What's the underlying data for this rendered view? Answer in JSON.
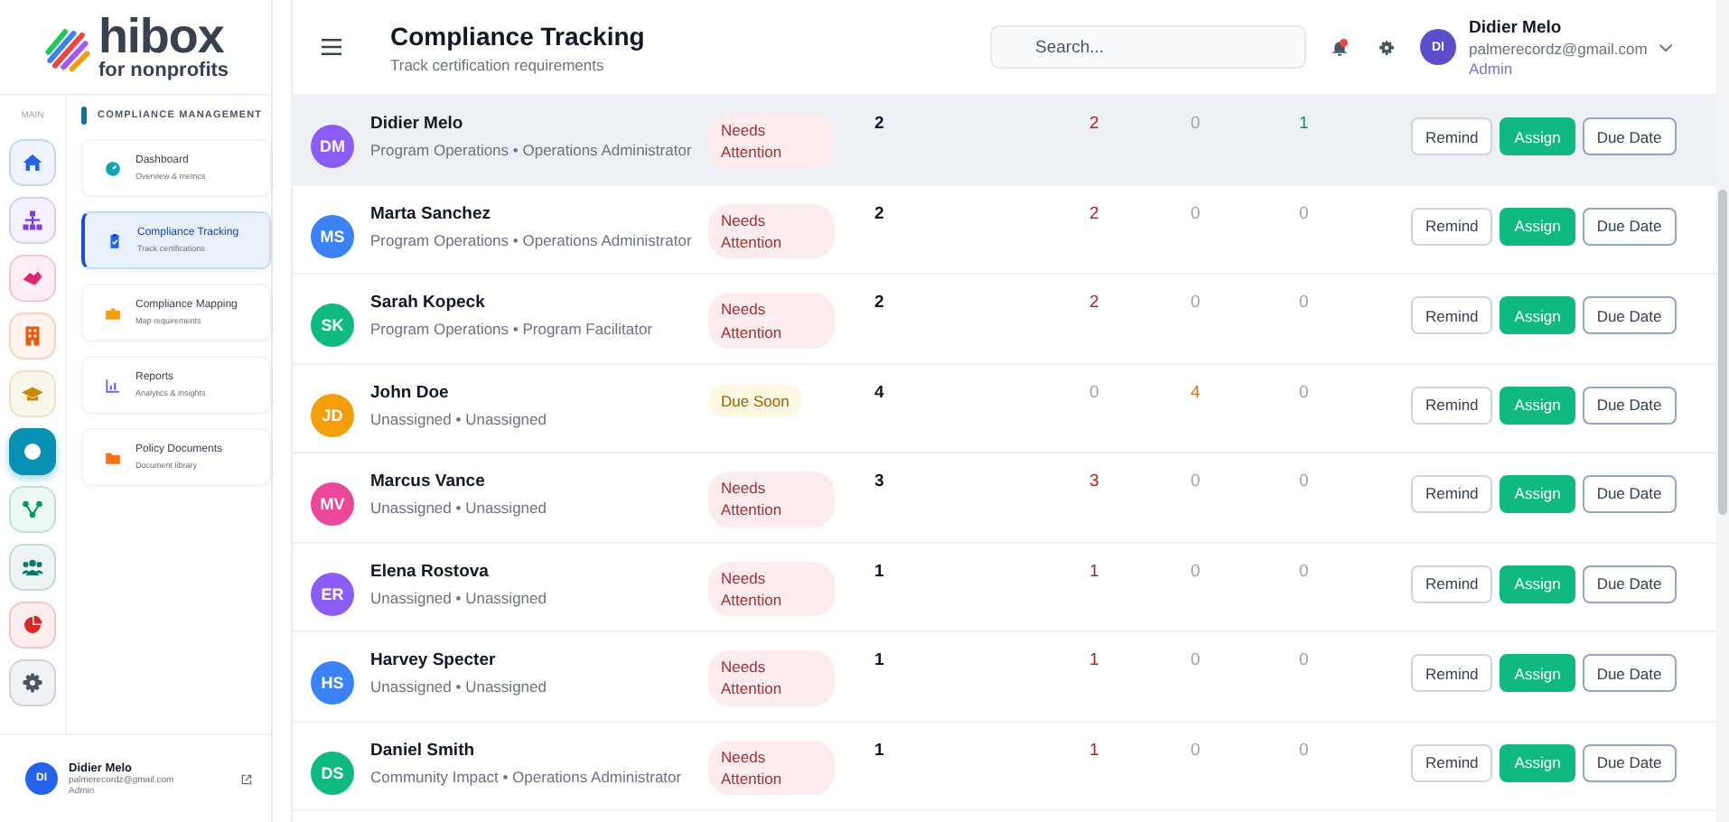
{
  "logo": {
    "name": "hibox",
    "tagline": "for nonprofits"
  },
  "rail": {
    "label": "MAIN",
    "items": [
      {
        "color": "#2563eb",
        "selected": false
      },
      {
        "color": "#7c3aed",
        "selected": false
      },
      {
        "color": "#db2777",
        "selected": false
      },
      {
        "color": "#ea580c",
        "selected": false
      },
      {
        "color": "#ca8a04",
        "selected": false
      },
      {
        "color": "#0891b2",
        "selected": true
      },
      {
        "color": "#059669",
        "selected": false
      },
      {
        "color": "#0f766e",
        "selected": false
      },
      {
        "color": "#dc2626",
        "selected": false
      },
      {
        "color": "#4b5563",
        "selected": false
      }
    ]
  },
  "subnav": {
    "title": "COMPLIANCE MANAGEMENT",
    "items": [
      {
        "label": "Dashboard",
        "hint": "Overview & metrics",
        "selected": false
      },
      {
        "label": "Compliance Tracking",
        "hint": "Track certifications",
        "selected": true
      },
      {
        "label": "Compliance Mapping",
        "hint": "Map requirements",
        "selected": false
      },
      {
        "label": "Reports",
        "hint": "Analytics & insights",
        "selected": false
      },
      {
        "label": "Policy Documents",
        "hint": "Document library",
        "selected": false
      }
    ]
  },
  "sidebar_user": {
    "initials": "DI",
    "name": "Didier Melo",
    "email": "palmerecordz@gmail.com",
    "role": "Admin"
  },
  "header": {
    "title": "Compliance Tracking",
    "subtitle": "Track certification requirements",
    "search": {
      "placeholder": "Search..."
    },
    "user": {
      "initials": "DI",
      "name": "Didier Melo",
      "email": "palmerecordz@gmail.com",
      "role": "Admin"
    }
  },
  "rows": [
    {
      "initials": "DM",
      "color": "#8b5cf6",
      "name": "Didier Melo",
      "detail": "Program Operations • Operations Administrator",
      "status": {
        "kind": "needs_attention",
        "label": "Needs Attention"
      },
      "counts": [
        "2",
        "2",
        "0",
        "1"
      ],
      "hovered": true,
      "actions": [
        "Remind",
        "Assign",
        "Due Date"
      ]
    },
    {
      "initials": "MS",
      "color": "#3b82f6",
      "name": "Marta Sanchez",
      "detail": "Program Operations • Operations Administrator",
      "status": {
        "kind": "needs_attention",
        "label": "Needs Attention"
      },
      "counts": [
        "2",
        "2",
        "0",
        "0"
      ],
      "hovered": false,
      "actions": [
        "Remind",
        "Assign",
        "Due Date"
      ]
    },
    {
      "initials": "SK",
      "color": "#10b981",
      "name": "Sarah Kopeck",
      "detail": "Program Operations • Program Facilitator",
      "status": {
        "kind": "needs_attention",
        "label": "Needs Attention"
      },
      "counts": [
        "2",
        "2",
        "0",
        "0"
      ],
      "hovered": false,
      "actions": [
        "Remind",
        "Assign",
        "Due Date"
      ]
    },
    {
      "initials": "JD",
      "color": "#f59e0b",
      "name": "John Doe",
      "detail": "Unassigned • Unassigned",
      "status": {
        "kind": "due_soon",
        "label": "Due Soon"
      },
      "counts": [
        "4",
        "0",
        "4",
        "0"
      ],
      "hovered": false,
      "actions": [
        "Remind",
        "Assign",
        "Due Date"
      ]
    },
    {
      "initials": "MV",
      "color": "#ec4899",
      "name": "Marcus Vance",
      "detail": "Unassigned • Unassigned",
      "status": {
        "kind": "needs_attention",
        "label": "Needs Attention"
      },
      "counts": [
        "3",
        "3",
        "0",
        "0"
      ],
      "hovered": false,
      "actions": [
        "Remind",
        "Assign",
        "Due Date"
      ]
    },
    {
      "initials": "ER",
      "color": "#8b5cf6",
      "name": "Elena Rostova",
      "detail": "Unassigned • Unassigned",
      "status": {
        "kind": "needs_attention",
        "label": "Needs Attention"
      },
      "counts": [
        "1",
        "1",
        "0",
        "0"
      ],
      "hovered": false,
      "actions": [
        "Remind",
        "Assign",
        "Due Date"
      ]
    },
    {
      "initials": "HS",
      "color": "#3b82f6",
      "name": "Harvey Specter",
      "detail": "Unassigned • Unassigned",
      "status": {
        "kind": "needs_attention",
        "label": "Needs Attention"
      },
      "counts": [
        "1",
        "1",
        "0",
        "0"
      ],
      "hovered": false,
      "actions": [
        "Remind",
        "Assign",
        "Due Date"
      ]
    },
    {
      "initials": "DS",
      "color": "#10b981",
      "name": "Daniel Smith",
      "detail": "Community Impact • Operations Administrator",
      "status": {
        "kind": "needs_attention",
        "label": "Needs Attention"
      },
      "counts": [
        "1",
        "1",
        "0",
        "0"
      ],
      "hovered": false,
      "actions": [
        "Remind",
        "Assign",
        "Due Date"
      ]
    }
  ]
}
